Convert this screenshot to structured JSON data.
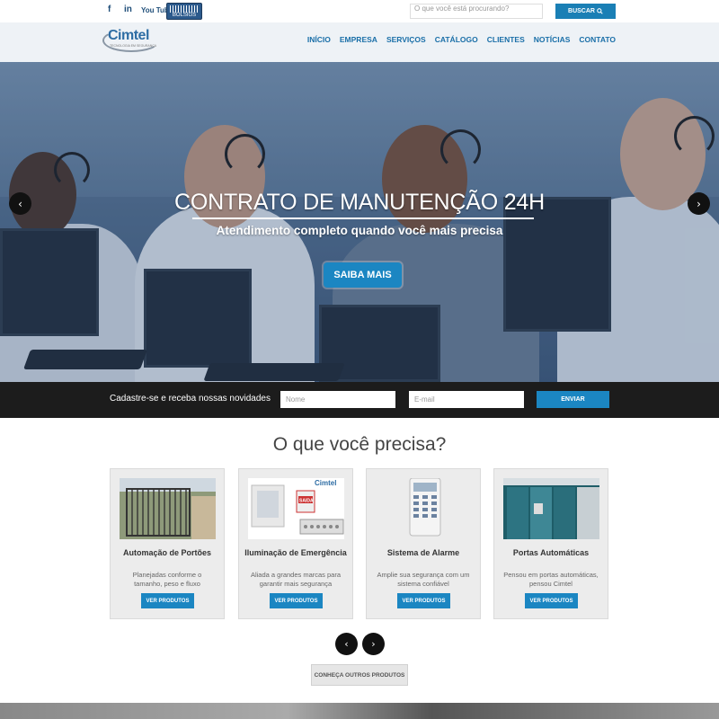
{
  "topbar": {
    "social": {
      "facebook": "f",
      "linkedin": "in",
      "youtube": "You Tube"
    },
    "badge_text": "BOLSIGS",
    "search_placeholder": "O que você está procurando?",
    "search_button": "BUSCAR"
  },
  "logo": {
    "name": "Cimtel",
    "tagline": "TECNOLOGIA EM SEGURANÇA"
  },
  "nav": {
    "items": [
      "INÍCIO",
      "EMPRESA",
      "SERVIÇOS",
      "CATÁLOGO",
      "CLIENTES",
      "NOTÍCIAS",
      "CONTATO"
    ]
  },
  "hero": {
    "title": "CONTRATO DE MANUTENÇÃO 24H",
    "subtitle": "Atendimento completo quando você mais precisa",
    "button": "SAIBA MAIS",
    "prev": "‹",
    "next": "›"
  },
  "newsletter": {
    "text": "Cadastre-se e receba nossas novidades",
    "name_placeholder": "Nome",
    "email_placeholder": "E-mail",
    "button": "ENVIAR"
  },
  "section": {
    "title": "O que você precisa?",
    "cards": [
      {
        "title": "Automação de Portões",
        "desc": "Planejadas conforme o tamanho, peso e fluxo",
        "button": "VER PRODUTOS"
      },
      {
        "title": "Iluminação de Emergência",
        "desc": "Aliada a grandes marcas para garantir mais segurança",
        "button": "VER PRODUTOS"
      },
      {
        "title": "Sistema de Alarme",
        "desc": "Amplie sua segurança com um sistema confiável",
        "button": "VER PRODUTOS"
      },
      {
        "title": "Portas Automáticas",
        "desc": "Pensou em portas automáticas, pensou Cimtel",
        "button": "VER PRODUTOS"
      }
    ],
    "card2_img_brand": "Cimtel",
    "card2_img_sign": "SAIDA",
    "prev": "‹",
    "next": "›",
    "more_button": "CONHEÇA OUTROS PRODUTOS"
  },
  "colors": {
    "accent": "#1b86c2",
    "nav_text": "#1a6fa8",
    "newsletter_bg": "#1c1c1c"
  }
}
